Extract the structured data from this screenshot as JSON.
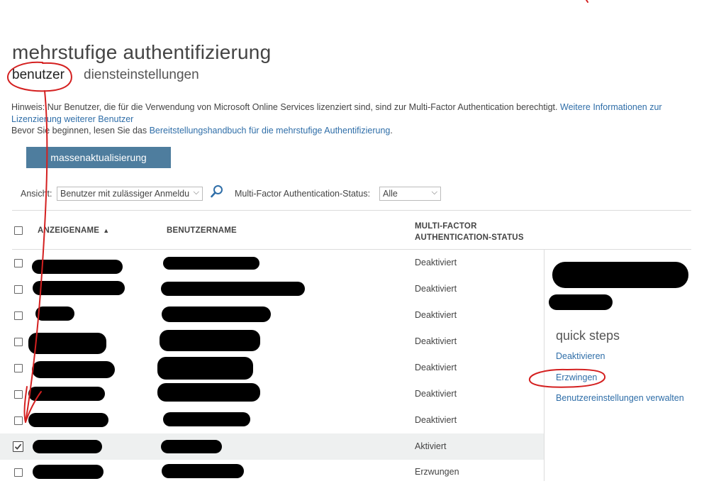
{
  "page": {
    "title": "mehrstufige authentifizierung",
    "tabs": [
      {
        "label": "benutzer",
        "active": true
      },
      {
        "label": "diensteinstellungen",
        "active": false
      }
    ]
  },
  "info": {
    "line1_text": "Hinweis: Nur Benutzer, die für die Verwendung von Microsoft Online Services lizenziert sind, sind zur Multi-Factor Authentication berechtigt.",
    "line1_link": "Weitere Informationen zur Lizenzierung weiterer Benutzer",
    "line2_prefix": "Bevor Sie beginnen, lesen Sie das",
    "line2_link": "Bereitstellungshandbuch für die mehrstufige Authentifizierung",
    "line2_suffix": "."
  },
  "toolbar": {
    "bulk_update_label": "massenaktualisierung",
    "view_label": "Ansicht:",
    "view_selected": "Benutzer mit zulässiger Anmeldu",
    "status_label": "Multi-Factor Authentication-Status:",
    "status_selected": "Alle"
  },
  "table": {
    "columns": {
      "display_name": "ANZEIGENAME",
      "username": "BENUTZERNAME",
      "mfa_status_line1": "MULTI-FACTOR",
      "mfa_status_line2": "AUTHENTICATION-STATUS"
    },
    "rows": [
      {
        "status": "Deaktiviert",
        "checked": false
      },
      {
        "status": "Deaktiviert",
        "checked": false
      },
      {
        "status": "Deaktiviert",
        "checked": false
      },
      {
        "status": "Deaktiviert",
        "checked": false
      },
      {
        "status": "Deaktiviert",
        "checked": false
      },
      {
        "status": "Deaktiviert",
        "checked": false
      },
      {
        "status": "Deaktiviert",
        "checked": false
      },
      {
        "status": "Aktiviert",
        "checked": true
      },
      {
        "status": "Erzwungen",
        "checked": false
      }
    ]
  },
  "quick_steps": {
    "title": "quick steps",
    "deactivate": "Deaktivieren",
    "enforce": "Erzwingen",
    "manage": "Benutzereinstellungen verwalten"
  },
  "colors": {
    "accent_button": "#4e7d9e",
    "link": "#2f6ea8",
    "annotation": "#d42020"
  }
}
